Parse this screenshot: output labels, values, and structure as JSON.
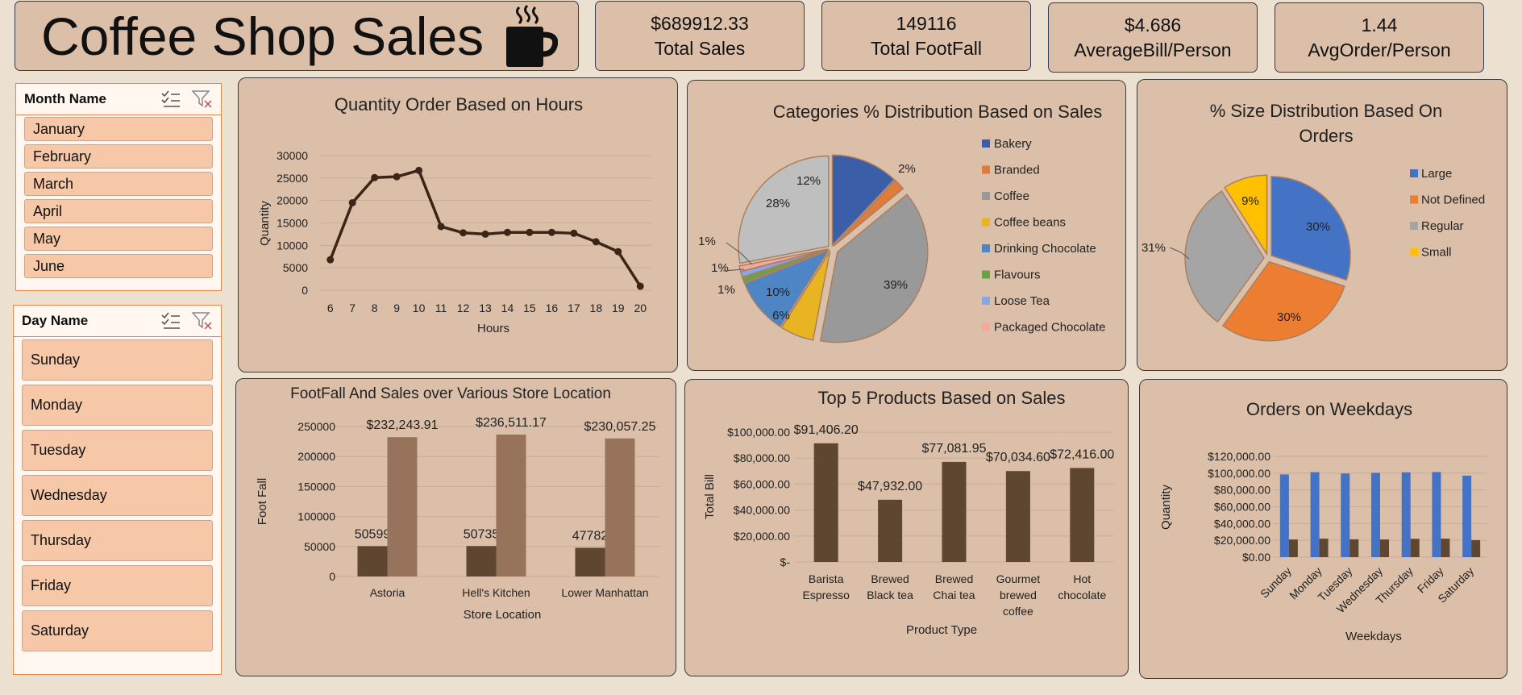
{
  "header": {
    "title": "Coffee Shop Sales",
    "icon": "coffee-cup-icon"
  },
  "kpis": [
    {
      "value": "$689912.33",
      "label": "Total Sales"
    },
    {
      "value": "149116",
      "label": "Total FootFall"
    },
    {
      "value": "$4.686",
      "label": "AverageBill/Person"
    },
    {
      "value": "1.44",
      "label": "AvgOrder/Person"
    }
  ],
  "month_slicer": {
    "label": "Month Name",
    "items": [
      "January",
      "February",
      "March",
      "April",
      "May",
      "June"
    ]
  },
  "day_slicer": {
    "label": "Day Name",
    "items": [
      "Sunday",
      "Monday",
      "Tuesday",
      "Wednesday",
      "Thursday",
      "Friday",
      "Saturday"
    ]
  },
  "colors": {
    "brown_dark": "#5e4630",
    "brown_light": "#96735a",
    "line": "#3a2516",
    "blue": "#4472c4"
  },
  "chart_data": [
    {
      "id": "hours",
      "type": "line",
      "title": "Quantity Order Based on Hours",
      "xlabel": "Hours",
      "ylabel": "Quantity",
      "x": [
        6,
        7,
        8,
        9,
        10,
        11,
        12,
        13,
        14,
        15,
        16,
        17,
        18,
        19,
        20
      ],
      "values": [
        6800,
        19500,
        25100,
        25300,
        26700,
        14200,
        12800,
        12500,
        12900,
        12900,
        12900,
        12700,
        10800,
        8600,
        900
      ],
      "ylim": [
        0,
        30000
      ],
      "yticks": [
        "30000",
        "25000",
        "20000",
        "15000",
        "10000",
        "5000",
        "0"
      ]
    },
    {
      "id": "categories",
      "type": "pie",
      "title": "Categories % Distribution Based on Sales",
      "labels": [
        "Bakery",
        "Branded",
        "Coffee",
        "Coffee beans",
        "Drinking Chocolate",
        "Flavours",
        "Loose Tea",
        "Packaged Chocolate"
      ],
      "values": [
        12,
        2,
        39,
        6,
        10,
        1,
        1,
        1
      ],
      "extra_slice": {
        "value": 28,
        "color": "#bfbfbf"
      },
      "slice_labels": [
        "12%",
        "2%",
        "39%",
        "6%",
        "10%",
        "1%",
        "1%",
        "1%",
        "28%"
      ],
      "colors": [
        "#3b5ea8",
        "#e07b3a",
        "#999999",
        "#e9b422",
        "#4e86c5",
        "#6aa143",
        "#8aa6e2",
        "#f4a99a"
      ]
    },
    {
      "id": "sizes",
      "type": "pie",
      "title": "% Size Distribution Based On Orders",
      "labels": [
        "Large",
        "Not Defined",
        "Regular",
        "Small"
      ],
      "values": [
        30,
        30,
        31,
        9
      ],
      "slice_labels": [
        "30%",
        "30%",
        "31%",
        "9%"
      ],
      "colors": [
        "#4472c4",
        "#ed7d31",
        "#a5a5a5",
        "#ffc000"
      ]
    },
    {
      "id": "stores",
      "type": "bar",
      "title": "FootFall And Sales over Various Store Location",
      "xlabel": "Store Location",
      "ylabel": "Foot Fall",
      "categories": [
        "Astoria",
        "Hell's Kitchen",
        "Lower Manhattan"
      ],
      "series": [
        {
          "values": [
            50599,
            50735,
            47782
          ],
          "labels": [
            "50599",
            "50735",
            "47782"
          ]
        },
        {
          "values": [
            232243.91,
            236511.17,
            230057.25
          ],
          "labels": [
            "$232,243.91",
            "$236,511.17",
            "$230,057.25"
          ]
        }
      ],
      "ylim": [
        0,
        250000
      ],
      "yticks": [
        "250000",
        "200000",
        "150000",
        "100000",
        "50000",
        "0"
      ]
    },
    {
      "id": "products",
      "type": "bar",
      "title": "Top 5 Products Based on Sales",
      "xlabel": "Product Type",
      "ylabel": "Total Bill",
      "categories": [
        [
          "Barista",
          "Espresso"
        ],
        [
          "Brewed",
          "Black tea"
        ],
        [
          "Brewed",
          "Chai tea"
        ],
        [
          "Gourmet",
          "brewed",
          "coffee"
        ],
        [
          "Hot",
          "chocolate"
        ]
      ],
      "values": [
        91406.2,
        47932.0,
        77081.95,
        70034.6,
        72416.0
      ],
      "value_labels": [
        "$91,406.20",
        "$47,932.00",
        "$77,081.95",
        "$70,034.60",
        "$72,416.00"
      ],
      "ylim": [
        0,
        100000
      ],
      "yticks": [
        "$100,000.00",
        "$80,000.00",
        "$60,000.00",
        "$40,000.00",
        "$20,000.00",
        "$-"
      ]
    },
    {
      "id": "weekdays",
      "type": "bar",
      "title": "Orders on Weekdays",
      "xlabel": "Weekdays",
      "ylabel": "Quantity",
      "categories": [
        "Sunday",
        "Monday",
        "Tuesday",
        "Wednesday",
        "Thursday",
        "Friday",
        "Saturday"
      ],
      "series": [
        {
          "values": [
            98500,
            101200,
            99600,
            100400,
            101000,
            101300,
            97000
          ]
        },
        {
          "values": [
            21000,
            22000,
            21200,
            21000,
            21800,
            22000,
            20300
          ]
        }
      ],
      "ylim": [
        0,
        120000
      ],
      "yticks": [
        "$120,000.00",
        "$100,000.00",
        "$80,000.00",
        "$60,000.00",
        "$40,000.00",
        "$20,000.00",
        "$0.00"
      ]
    }
  ]
}
